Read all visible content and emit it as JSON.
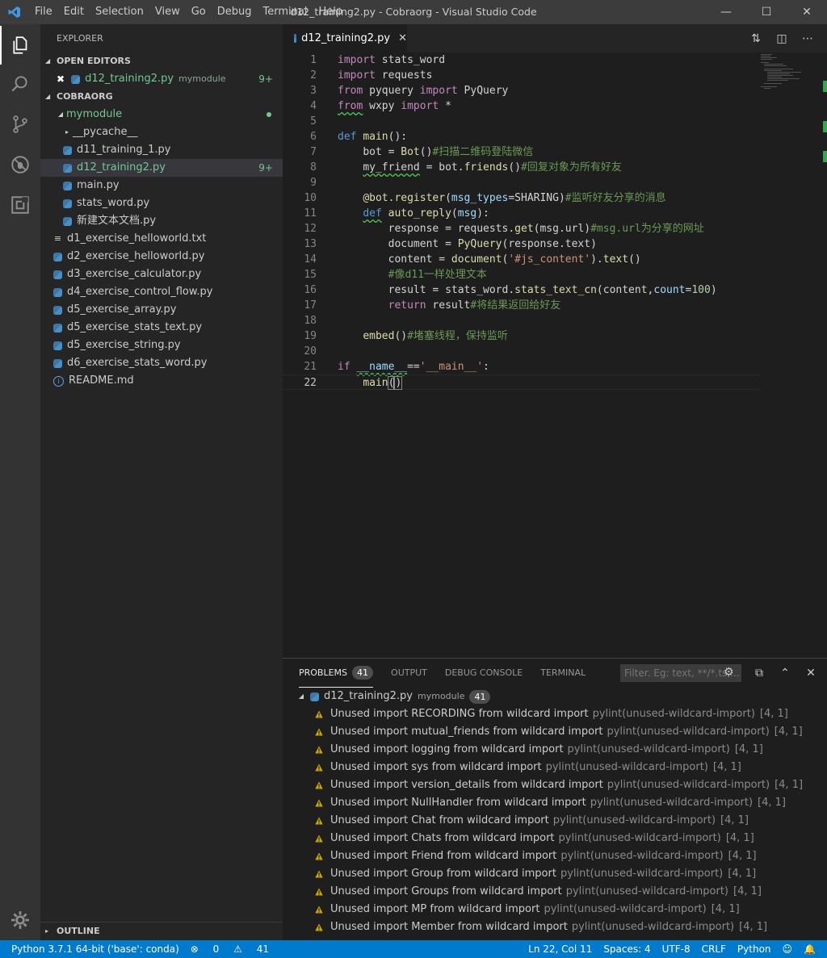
{
  "window": {
    "title": "d12_training2.py - Cobraorg - Visual Studio Code",
    "menu": [
      "File",
      "Edit",
      "Selection",
      "View",
      "Go",
      "Debug",
      "Terminal",
      "Help"
    ]
  },
  "sidebar": {
    "header": "EXPLORER",
    "open_editors": {
      "label": "OPEN EDITORS",
      "items": [
        {
          "name": "d12_training2.py",
          "folder": "mymodule",
          "badge": "9+"
        }
      ]
    },
    "workspace": {
      "label": "COBRAORG",
      "folder": "mymodule",
      "pycache": "__pycache__",
      "folder_items": [
        {
          "name": "d11_training_1.py",
          "badge": ""
        },
        {
          "name": "d12_training2.py",
          "badge": "9+"
        },
        {
          "name": "main.py",
          "badge": ""
        },
        {
          "name": "stats_word.py",
          "badge": ""
        },
        {
          "name": "新建文本文档.py",
          "badge": ""
        }
      ],
      "files": [
        {
          "name": "d1_exercise_helloworld.txt",
          "icon": "text-file-icon"
        },
        {
          "name": "d2_exercise_helloworld.py",
          "icon": "python-file-icon"
        },
        {
          "name": "d3_exercise_calculator.py",
          "icon": "python-file-icon"
        },
        {
          "name": "d4_exercise_control_flow.py",
          "icon": "python-file-icon"
        },
        {
          "name": "d5_exercise_array.py",
          "icon": "python-file-icon"
        },
        {
          "name": "d5_exercise_stats_text.py",
          "icon": "python-file-icon"
        },
        {
          "name": "d5_exercise_string.py",
          "icon": "python-file-icon"
        },
        {
          "name": "d6_exercise_stats_word.py",
          "icon": "python-file-icon"
        },
        {
          "name": "README.md",
          "icon": "info-file-icon"
        }
      ]
    },
    "outline": "OUTLINE"
  },
  "editor": {
    "tab": "d12_training2.py",
    "line_numbers": [
      "1",
      "2",
      "3",
      "4",
      "5",
      "6",
      "7",
      "8",
      "9",
      "10",
      "11",
      "12",
      "13",
      "14",
      "15",
      "16",
      "17",
      "18",
      "19",
      "20",
      "21",
      "22"
    ],
    "code": {
      "l1_kw": "import",
      "l1_rest": " stats_word",
      "l2_kw": "import",
      "l2_rest": " requests",
      "l3_kw1": "from",
      "l3_mod": " pyquery ",
      "l3_kw2": "import",
      "l3_rest": " PyQuery",
      "l4_kw1": "from",
      "l4_mod": " wxpy ",
      "l4_kw2": "import",
      "l4_rest": " *",
      "l6_kw": "def",
      "l6_fn": "main",
      "l6_rest": "():",
      "l7_a": "bot = ",
      "l7_fn": "Bot",
      "l7_b": "()",
      "l7_cm": "#扫描二维码登陆微信",
      "l8_sq": "my_friend",
      "l8_a": " = bot.",
      "l8_fn": "friends",
      "l8_b": "()",
      "l8_cm": "#回复对象为所有好友",
      "l10_dec": "@bot.register",
      "l10_a": "(",
      "l10_pr": "msg_types",
      "l10_b": "=SHARING)",
      "l10_cm": "#监听好友分享的消息",
      "l11_kw": "def",
      "l11_fn": "auto_reply",
      "l11_a": "(",
      "l11_pr": "msg",
      "l11_b": "):",
      "l12_a": "response = requests.",
      "l12_fn": "get",
      "l12_b": "(msg.url)",
      "l12_cm": "#msg.url为分享的网址",
      "l13_a": "document = ",
      "l13_fn": "PyQuery",
      "l13_b": "(response.text)",
      "l14_a": "content = ",
      "l14_fn": "document",
      "l14_b": "(",
      "l14_st": "'#js_content'",
      "l14_c": ").",
      "l14_fn2": "text",
      "l14_d": "()",
      "l15_cm": "#像d11一样处理文本",
      "l16_a": "result = stats_word.",
      "l16_fn": "stats_text_cn",
      "l16_b": "(content,",
      "l16_pr": "count",
      "l16_c": "=",
      "l16_nm": "100",
      "l16_d": ")",
      "l17_kw": "return",
      "l17_a": " result",
      "l17_cm": "#将结果返回给好友",
      "l19_fn": "embed",
      "l19_a": "()",
      "l19_cm": "#堵塞线程，保持监听",
      "l21_kw": "if",
      "l21_sq": "__name__",
      "l21_a": "==",
      "l21_st": "'__main__'",
      "l21_b": ":",
      "l22_fn": "main",
      "l22_a": "(",
      "l22_b": ")"
    }
  },
  "panel": {
    "tabs": {
      "problems": "PROBLEMS",
      "problems_count": "41",
      "output": "OUTPUT",
      "debug": "DEBUG CONSOLE",
      "terminal": "TERMINAL"
    },
    "filter_placeholder": "Filter. Eg: text, **/*.ts,...",
    "file": {
      "name": "d12_training2.py",
      "folder": "mymodule",
      "count": "41"
    },
    "problems": [
      {
        "msg": "Unused import RECORDING from wildcard import",
        "src": "pylint(unused-wildcard-import)",
        "pos": "[4, 1]"
      },
      {
        "msg": "Unused import mutual_friends from wildcard import",
        "src": "pylint(unused-wildcard-import)",
        "pos": "[4, 1]"
      },
      {
        "msg": "Unused import logging from wildcard import",
        "src": "pylint(unused-wildcard-import)",
        "pos": "[4, 1]"
      },
      {
        "msg": "Unused import sys from wildcard import",
        "src": "pylint(unused-wildcard-import)",
        "pos": "[4, 1]"
      },
      {
        "msg": "Unused import version_details from wildcard import",
        "src": "pylint(unused-wildcard-import)",
        "pos": "[4, 1]"
      },
      {
        "msg": "Unused import NullHandler from wildcard import",
        "src": "pylint(unused-wildcard-import)",
        "pos": "[4, 1]"
      },
      {
        "msg": "Unused import Chat from wildcard import",
        "src": "pylint(unused-wildcard-import)",
        "pos": "[4, 1]"
      },
      {
        "msg": "Unused import Chats from wildcard import",
        "src": "pylint(unused-wildcard-import)",
        "pos": "[4, 1]"
      },
      {
        "msg": "Unused import Friend from wildcard import",
        "src": "pylint(unused-wildcard-import)",
        "pos": "[4, 1]"
      },
      {
        "msg": "Unused import Group from wildcard import",
        "src": "pylint(unused-wildcard-import)",
        "pos": "[4, 1]"
      },
      {
        "msg": "Unused import Groups from wildcard import",
        "src": "pylint(unused-wildcard-import)",
        "pos": "[4, 1]"
      },
      {
        "msg": "Unused import MP from wildcard import",
        "src": "pylint(unused-wildcard-import)",
        "pos": "[4, 1]"
      },
      {
        "msg": "Unused import Member from wildcard import",
        "src": "pylint(unused-wildcard-import)",
        "pos": "[4, 1]"
      }
    ]
  },
  "statusbar": {
    "interpreter": "Python 3.7.1 64-bit ('base': conda)",
    "errors": "0",
    "warnings": "41",
    "cursor": "Ln 22, Col 11",
    "spaces": "Spaces: 4",
    "encoding": "UTF-8",
    "eol": "CRLF",
    "language": "Python"
  },
  "colors": {
    "accent": "#007acc",
    "warning": "#cca700",
    "git_added": "#73c991"
  }
}
